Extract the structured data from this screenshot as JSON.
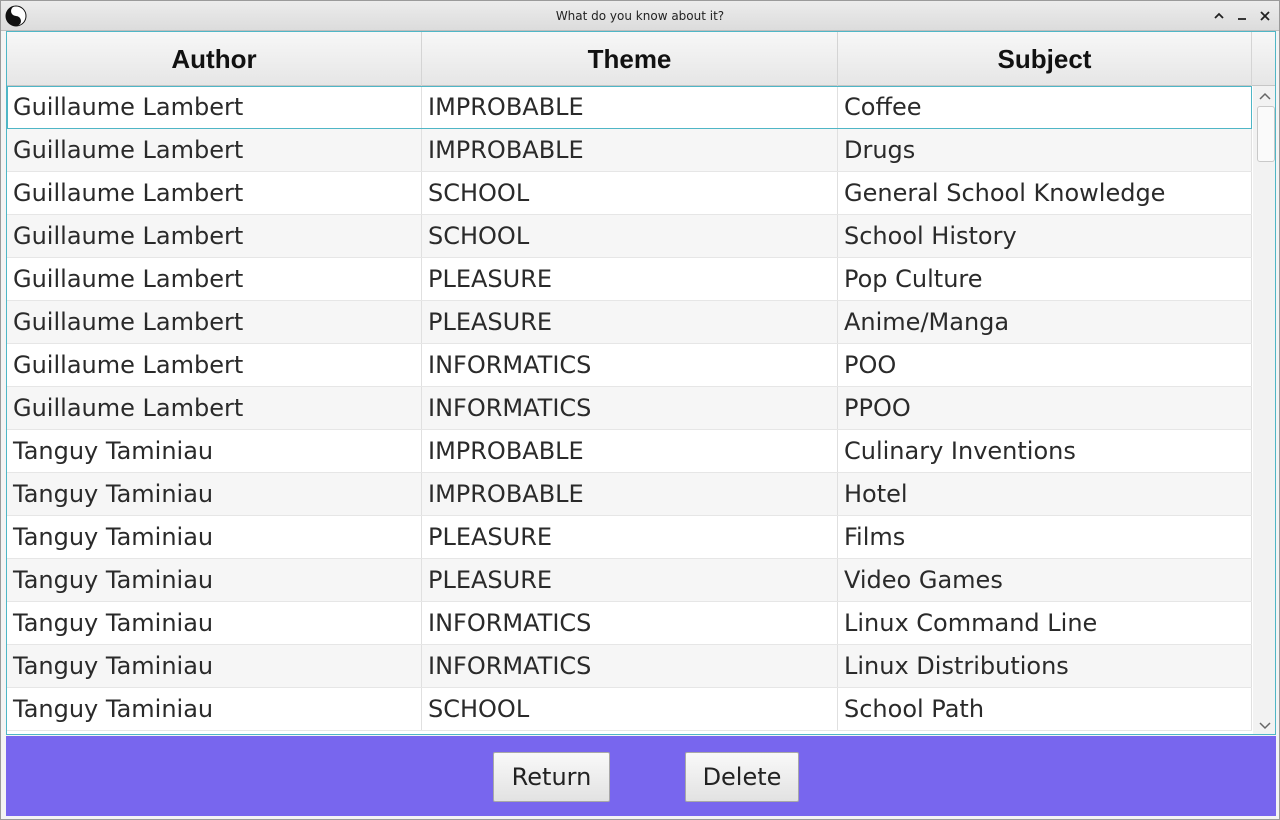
{
  "window": {
    "title": "What do you know about it?",
    "controls": {
      "maximize": "^",
      "minimize": "–",
      "close": "×"
    }
  },
  "table": {
    "columns": [
      "Author",
      "Theme",
      "Subject"
    ],
    "selected_row": 0,
    "rows": [
      [
        "Guillaume Lambert",
        "IMPROBABLE",
        "Coffee"
      ],
      [
        "Guillaume Lambert",
        "IMPROBABLE",
        "Drugs"
      ],
      [
        "Guillaume Lambert",
        "SCHOOL",
        "General School Knowledge"
      ],
      [
        "Guillaume Lambert",
        "SCHOOL",
        "School History"
      ],
      [
        "Guillaume Lambert",
        "PLEASURE",
        "Pop Culture"
      ],
      [
        "Guillaume Lambert",
        "PLEASURE",
        "Anime/Manga"
      ],
      [
        "Guillaume Lambert",
        "INFORMATICS",
        "POO"
      ],
      [
        "Guillaume Lambert",
        "INFORMATICS",
        "PPOO"
      ],
      [
        "Tanguy Taminiau",
        "IMPROBABLE",
        "Culinary Inventions"
      ],
      [
        "Tanguy Taminiau",
        "IMPROBABLE",
        "Hotel"
      ],
      [
        "Tanguy Taminiau",
        "PLEASURE",
        "Films"
      ],
      [
        "Tanguy Taminiau",
        "PLEASURE",
        "Video Games"
      ],
      [
        "Tanguy Taminiau",
        "INFORMATICS",
        "Linux Command Line"
      ],
      [
        "Tanguy Taminiau",
        "INFORMATICS",
        "Linux Distributions"
      ],
      [
        "Tanguy Taminiau",
        "SCHOOL",
        "School Path"
      ]
    ]
  },
  "footer": {
    "return_label": "Return",
    "delete_label": "Delete",
    "background": "#7866ee"
  },
  "icons": {
    "app": "yin-yang-icon",
    "scroll_up": "chevron-up-icon",
    "scroll_down": "chevron-down-icon"
  }
}
